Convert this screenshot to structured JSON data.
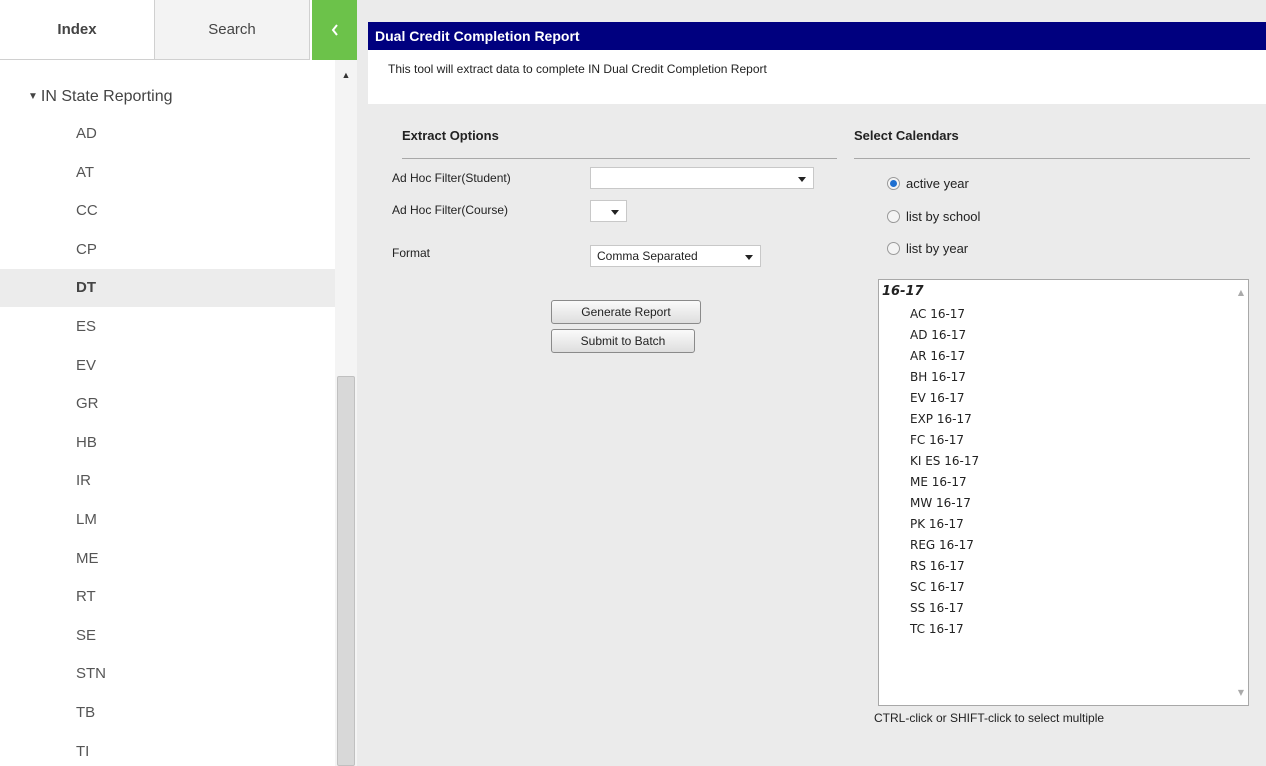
{
  "sidebar": {
    "tabs": {
      "index": "Index",
      "search": "Search"
    },
    "collapse_icon": "chevron-left-icon",
    "tree_header": "IN State Reporting",
    "items": [
      "AD",
      "AT",
      "CC",
      "CP",
      "DT",
      "ES",
      "EV",
      "GR",
      "HB",
      "IR",
      "LM",
      "ME",
      "RT",
      "SE",
      "STN",
      "TB",
      "TI"
    ],
    "selected": "DT"
  },
  "main": {
    "title": "Dual Credit Completion Report",
    "description": "This tool will extract data to complete IN Dual Credit Completion Report",
    "extract": {
      "title": "Extract Options",
      "adhoc_student_label": "Ad Hoc Filter(Student)",
      "adhoc_student_value": "",
      "adhoc_course_label": "Ad Hoc Filter(Course)",
      "adhoc_course_value": "",
      "format_label": "Format",
      "format_value": "Comma Separated",
      "generate_button": "Generate Report",
      "batch_button": "Submit to Batch"
    },
    "calendars": {
      "title": "Select Calendars",
      "options": [
        {
          "label": "active year",
          "checked": true
        },
        {
          "label": "list by school",
          "checked": false
        },
        {
          "label": "list by year",
          "checked": false
        }
      ],
      "group_label": "16-17",
      "items": [
        "AC 16-17",
        "AD 16-17",
        "AR 16-17",
        "BH 16-17",
        "EV 16-17",
        "EXP 16-17",
        "FC 16-17",
        "KI ES 16-17",
        "ME 16-17",
        "MW 16-17",
        "PK 16-17",
        "REG 16-17",
        "RS 16-17",
        "SC 16-17",
        "SS 16-17",
        "TC 16-17"
      ],
      "hint": "CTRL-click or SHIFT-click to select multiple"
    },
    "colors": {
      "title_bar": "#00007f",
      "collapse_button": "#6cc24a",
      "radio_checked": "#1e6fd0"
    }
  }
}
